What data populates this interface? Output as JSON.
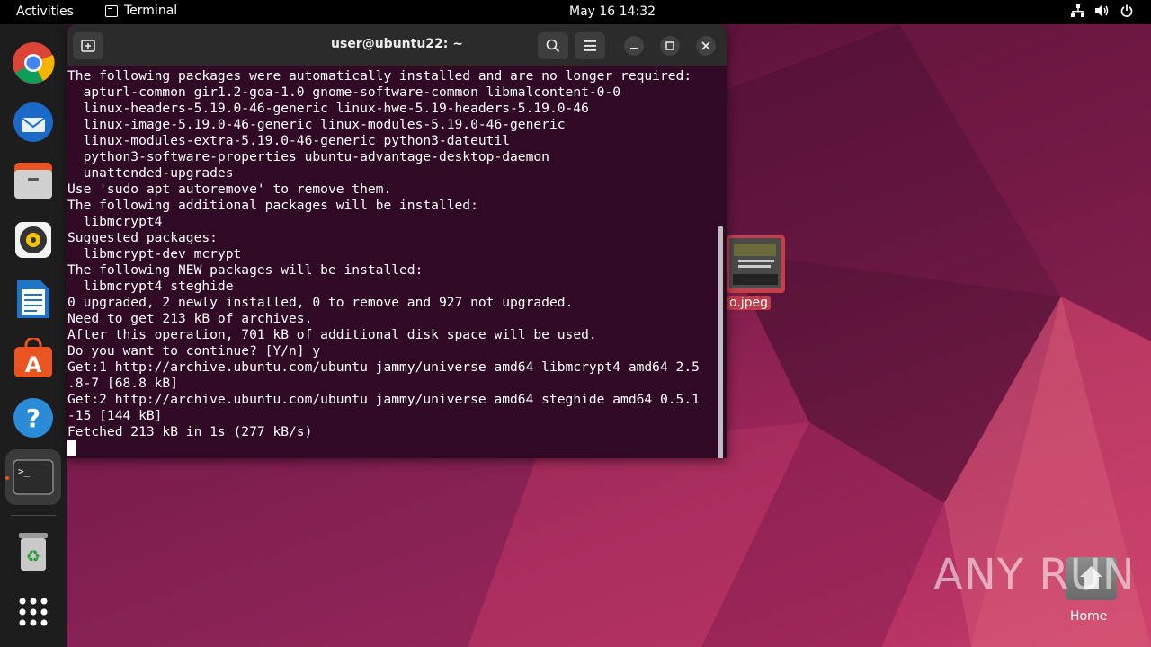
{
  "topbar": {
    "activities": "Activities",
    "app_name": "Terminal",
    "clock": "May 16  14:32"
  },
  "terminal": {
    "title": "user@ubuntu22: ~",
    "output": "The following packages were automatically installed and are no longer required:\n  apturl-common gir1.2-goa-1.0 gnome-software-common libmalcontent-0-0\n  linux-headers-5.19.0-46-generic linux-hwe-5.19-headers-5.19.0-46\n  linux-image-5.19.0-46-generic linux-modules-5.19.0-46-generic\n  linux-modules-extra-5.19.0-46-generic python3-dateutil\n  python3-software-properties ubuntu-advantage-desktop-daemon\n  unattended-upgrades\nUse 'sudo apt autoremove' to remove them.\nThe following additional packages will be installed:\n  libmcrypt4\nSuggested packages:\n  libmcrypt-dev mcrypt\nThe following NEW packages will be installed:\n  libmcrypt4 steghide\n0 upgraded, 2 newly installed, 0 to remove and 927 not upgraded.\nNeed to get 213 kB of archives.\nAfter this operation, 701 kB of additional disk space will be used.\nDo you want to continue? [Y/n] y\nGet:1 http://archive.ubuntu.com/ubuntu jammy/universe amd64 libmcrypt4 amd64 2.5\n.8-7 [68.8 kB]\nGet:2 http://archive.ubuntu.com/ubuntu jammy/universe amd64 steghide amd64 0.5.1\n-15 [144 kB]\nFetched 213 kB in 1s (277 kB/s)"
  },
  "desktop": {
    "image_file_label": "o.jpeg",
    "home_label": "Home"
  },
  "watermark": "ANY RUN",
  "dock": {
    "items": [
      "chrome-icon",
      "thunderbird-icon",
      "files-icon",
      "rhythmbox-icon",
      "writer-icon",
      "app-center-icon",
      "help-icon",
      "terminal-icon",
      "trash-icon",
      "app-grid-icon"
    ]
  },
  "colors": {
    "terminal_bg": "#300a24",
    "accent": "#e95420"
  }
}
